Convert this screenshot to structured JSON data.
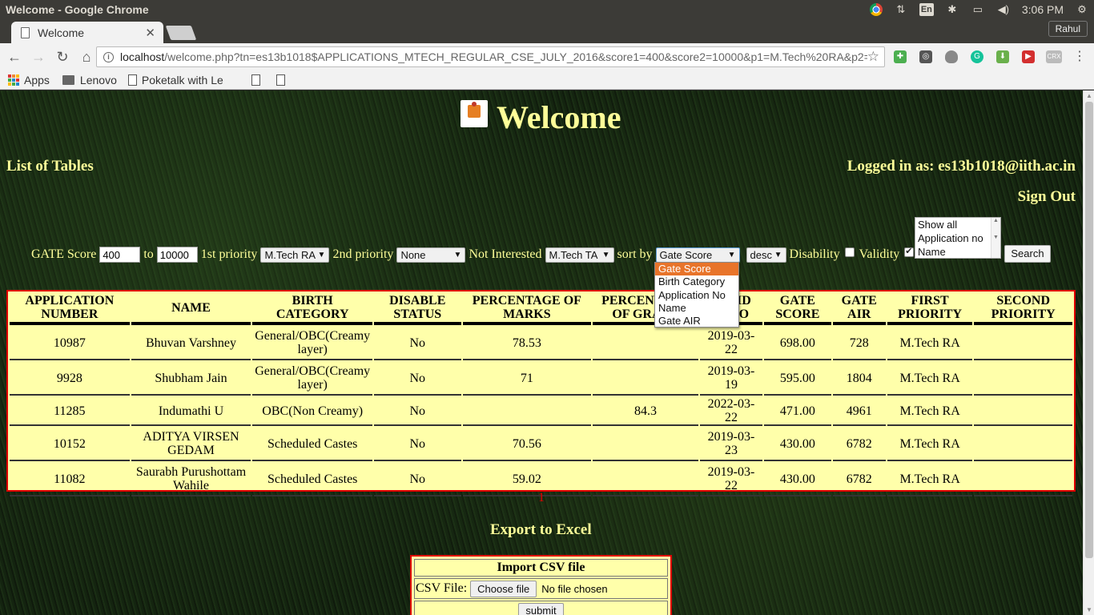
{
  "os": {
    "window_title": "Welcome - Google Chrome",
    "lang": "En",
    "clock": "3:06 PM"
  },
  "browser": {
    "tab_title": "Welcome",
    "user": "Rahul",
    "url_host": "localhost",
    "url_path": "/welcome.php?tn=es13b1018$APPLICATIONS_MTECH_REGULAR_CSE_JULY_2016&score1=400&score2=10000&p1=M.Tech%20RA&p2=N",
    "bookmarks": [
      "Apps",
      "Lenovo",
      "Poketalk with Le"
    ]
  },
  "page": {
    "title": "Welcome",
    "list_of_tables": "List of Tables",
    "logged_in": "Logged in as: es13b1018@iith.ac.in",
    "sign_out": "Sign Out",
    "export": "Export to Excel",
    "pager": "1"
  },
  "filters": {
    "gate_score_label": "GATE Score",
    "score_from": "400",
    "to_label": "to",
    "score_to": "10000",
    "p1_label": "1st priority",
    "p1_value": "M.Tech RA",
    "p2_label": "2nd priority",
    "p2_value": "None",
    "ni_label": "Not Interested",
    "ni_value": "M.Tech TA",
    "sort_label": "sort by",
    "sort_value": "Gate Score",
    "order_value": "desc",
    "disability_label": "Disability",
    "validity_label": "Validity",
    "search": "Search",
    "listbox": [
      "Show all",
      "Application no",
      "Name"
    ],
    "sort_options": [
      "Gate Score",
      "Birth Category",
      "Application No",
      "Name",
      "Gate AIR"
    ]
  },
  "table": {
    "headers": [
      "APPLICATION NUMBER",
      "NAME",
      "BIRTH CATEGORY",
      "DISABLE STATUS",
      "PERCENTAGE OF MARKS",
      "PERCENTAGE OF GRADE",
      "VALID UPTO",
      "GATE SCORE",
      "GATE AIR",
      "FIRST PRIORITY",
      "SECOND PRIORITY"
    ],
    "rows": [
      [
        "10987",
        "Bhuvan Varshney",
        "General/OBC(Creamy layer)",
        "No",
        "78.53",
        "",
        "2019-03-22",
        "698.00",
        "728",
        "M.Tech RA",
        ""
      ],
      [
        "9928",
        "Shubham Jain",
        "General/OBC(Creamy layer)",
        "No",
        "71",
        "",
        "2019-03-19",
        "595.00",
        "1804",
        "M.Tech RA",
        ""
      ],
      [
        "11285",
        "Indumathi U",
        "OBC(Non Creamy)",
        "No",
        "",
        "84.3",
        "2022-03-22",
        "471.00",
        "4961",
        "M.Tech RA",
        ""
      ],
      [
        "10152",
        "ADITYA VIRSEN GEDAM",
        "Scheduled Castes",
        "No",
        "70.56",
        "",
        "2019-03-23",
        "430.00",
        "6782",
        "M.Tech RA",
        ""
      ],
      [
        "11082",
        "Saurabh Purushottam Wahile",
        "Scheduled Castes",
        "No",
        "59.02",
        "",
        "2019-03-22",
        "430.00",
        "6782",
        "M.Tech RA",
        ""
      ]
    ]
  },
  "import": {
    "title": "Import CSV file",
    "csv_label": "CSV File:",
    "choose": "Choose file",
    "no_file": "No file chosen",
    "submit": "submit"
  }
}
